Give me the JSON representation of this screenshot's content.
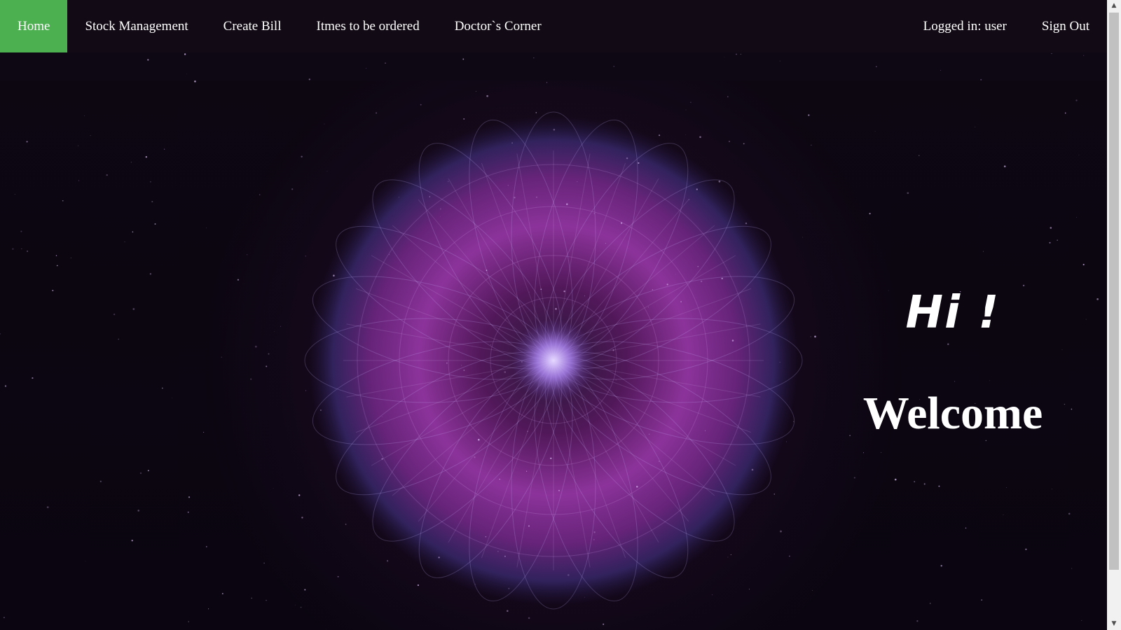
{
  "nav": {
    "items": [
      {
        "label": "Home",
        "active": true
      },
      {
        "label": "Stock Management",
        "active": false
      },
      {
        "label": "Create Bill",
        "active": false
      },
      {
        "label": "Itmes to be ordered",
        "active": false
      },
      {
        "label": "Doctor`s Corner",
        "active": false
      }
    ],
    "logged_in": "Logged in: user",
    "sign_out": "Sign Out"
  },
  "hero": {
    "greeting": "Hi !",
    "welcome": "Welcome"
  },
  "colors": {
    "nav_background": "#120a14",
    "active_tab": "#4caf50",
    "orb_primary": "#b040c0",
    "orb_edge": "#3a2a70",
    "text": "#ffffff"
  },
  "scrollbar": {
    "up_icon": "triangle-up-icon",
    "down_icon": "triangle-down-icon"
  }
}
